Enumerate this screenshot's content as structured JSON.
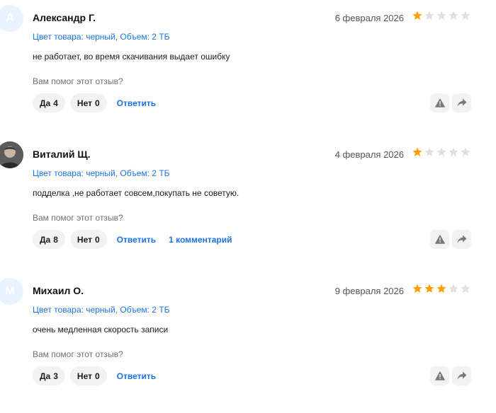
{
  "colors": {
    "accent": "#1a73e8",
    "star_filled": "#ff9f0a",
    "star_empty": "#e0e0e0"
  },
  "reviews": [
    {
      "avatar_letter": "А",
      "avatar_type": "letter",
      "name": "Александр Г.",
      "date": "6 февраля 2026",
      "rating": 1,
      "variant": "Цвет товара: черный, Объем: 2 ТБ",
      "text": "не работает, во время скачивания выдает ошибку",
      "helpful_prompt": "Вам помог этот отзыв?",
      "yes_label": "Да",
      "yes_count": "4",
      "no_label": "Нет",
      "no_count": "0",
      "reply_label": "Ответить",
      "comments_label": ""
    },
    {
      "avatar_letter": "",
      "avatar_type": "photo",
      "name": "Виталий Щ.",
      "date": "4 февраля 2026",
      "rating": 1,
      "variant": "Цвет товара: черный, Объем: 2 ТБ",
      "text": "подделка ,не работает совсем,покупать не советую.",
      "helpful_prompt": "Вам помог этот отзыв?",
      "yes_label": "Да",
      "yes_count": "8",
      "no_label": "Нет",
      "no_count": "0",
      "reply_label": "Ответить",
      "comments_label": "1 комментарий"
    },
    {
      "avatar_letter": "М",
      "avatar_type": "letter",
      "name": "Михаил О.",
      "date": "9 февраля 2026",
      "rating": 3,
      "variant": "Цвет товара: черный, Объем: 2 ТБ",
      "text": "очень медленная скорость записи",
      "helpful_prompt": "Вам помог этот отзыв?",
      "yes_label": "Да",
      "yes_count": "3",
      "no_label": "Нет",
      "no_count": "0",
      "reply_label": "Ответить",
      "comments_label": ""
    }
  ],
  "icons": {
    "report": "warning-triangle-icon",
    "share": "share-arrow-icon",
    "star": "star-icon"
  }
}
